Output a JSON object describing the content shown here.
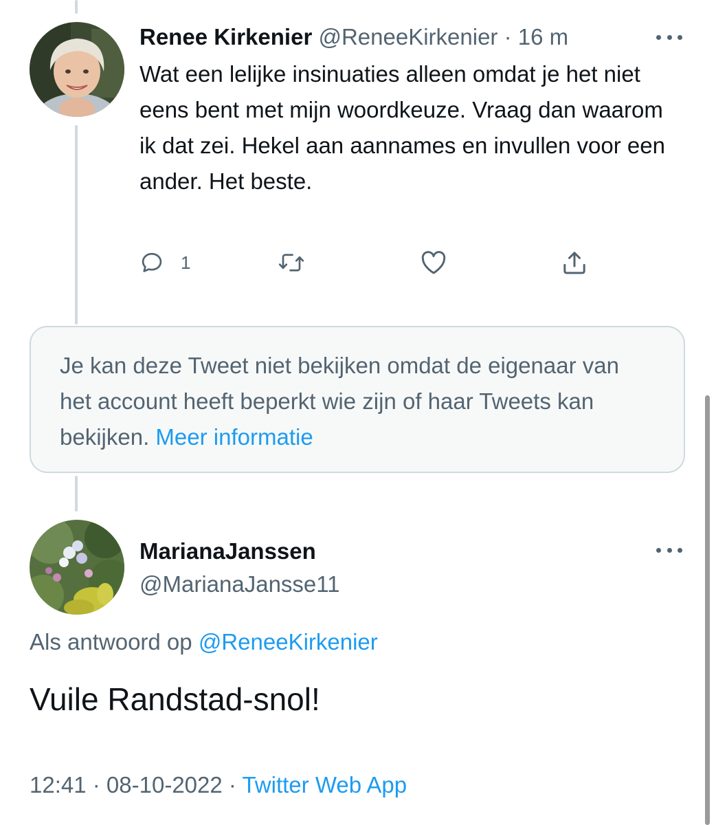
{
  "tweet1": {
    "author_name": "Renee Kirkenier",
    "author_handle": "@ReneeKirkenier",
    "separator": " · ",
    "time": "16 m",
    "text": "Wat een lelijke insinuaties alleen omdat je het niet eens bent met mijn woordkeuze. Vraag dan waarom ik dat zei. Hekel aan aannames en invullen voor een ander. Het beste.",
    "reply_count": "1",
    "icons": {
      "reply": "reply-bubble-icon",
      "retweet": "retweet-icon",
      "like": "heart-icon",
      "share": "share-icon",
      "more": "more-dots-icon"
    }
  },
  "notice": {
    "text": "Je kan deze Tweet niet bekijken omdat de eigenaar van het account heeft beperkt wie zijn of haar Tweets kan bekijken.",
    "link": "Meer informatie"
  },
  "tweet2": {
    "author_name": "MarianaJanssen",
    "author_handle": "@MarianaJansse11",
    "reply_prefix": "Als antwoord op ",
    "reply_to": "@ReneeKirkenier",
    "text": "Vuile Randstad-snol!",
    "time": "12:41",
    "separator": " · ",
    "date": "08-10-2022",
    "source": "Twitter Web App"
  },
  "colors": {
    "text_primary": "#0f1419",
    "text_secondary": "#536471",
    "link": "#1d9bf0",
    "border": "#cfd9de",
    "notice_bg": "#f7f9f9"
  }
}
